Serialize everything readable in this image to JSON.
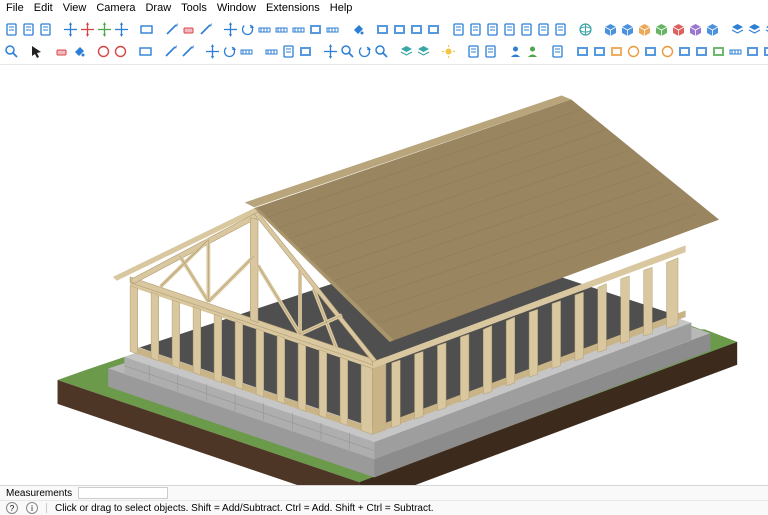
{
  "menu": {
    "items": [
      "File",
      "Edit",
      "View",
      "Camera",
      "Draw",
      "Tools",
      "Window",
      "Extensions",
      "Help"
    ]
  },
  "toolbars": {
    "row1_groups": [
      [
        "new-doc",
        "open-doc",
        "save-doc"
      ],
      [
        "move-tool",
        "red-axis",
        "green-axis",
        "blue-axis"
      ],
      [
        "rectangle-tool"
      ],
      [
        "line-tool",
        "eraser-tool",
        "offset-tool"
      ],
      [
        "move-crosshair",
        "rotate-tool",
        "scale-tool",
        "tape-tool",
        "protractor",
        "text-tool",
        "dimension-tool"
      ],
      [
        "paint-bucket"
      ],
      [
        "shadow-1",
        "shadow-2",
        "shadow-3",
        "shadow-4"
      ],
      [
        "copy-doc",
        "doc-a",
        "doc-b",
        "doc-c",
        "doc-d",
        "doc-e",
        "doc-f"
      ],
      [
        "globe-tool"
      ],
      [
        "iso-view",
        "cube-blue",
        "cube-orange",
        "cube-green",
        "cube-red",
        "cube-purple",
        "cube-cyan"
      ],
      [
        "layer-a",
        "layer-b",
        "layer-c",
        "layer-d"
      ],
      [
        "union",
        "subtract",
        "intersect",
        "trim"
      ]
    ],
    "row2_groups": [
      [
        "search-tool"
      ],
      [
        "select-tool"
      ],
      [
        "eraser-2",
        "paint-2"
      ],
      [
        "undo",
        "redo"
      ],
      [
        "rect-2"
      ],
      [
        "push-pull",
        "pencil"
      ],
      [
        "move-2",
        "rotate-2",
        "scale-2"
      ],
      [
        "tape-2",
        "doc-edit",
        "section-plane"
      ],
      [
        "pan-tool",
        "zoom-tool",
        "orbit-tool",
        "zoom-extents"
      ],
      [
        "layers-stack",
        "layers-stack-2"
      ],
      [
        "sun-icon"
      ],
      [
        "outliner",
        "scenes"
      ],
      [
        "person-icon",
        "add-person"
      ],
      [
        "warehouse-icon"
      ],
      [
        "wall-tool",
        "column-tool",
        "beam-tool",
        "roof-tool",
        "slab-tool",
        "floor-tool",
        "framing-tool",
        "truss-tool",
        "cladding-tool",
        "ruler-tool",
        "section-tool",
        "view-tool",
        "settings-tool"
      ]
    ]
  },
  "status": {
    "measurements_label": "Measurements",
    "measurements_value": "",
    "hint": "Click or drag to select objects. Shift = Add/Subtract. Ctrl = Add. Shift + Ctrl = Subtract.",
    "help_symbol": "?",
    "info_symbol": "i"
  },
  "colors": {
    "menu_text": "#333333",
    "icon_blue": "#2d7fd6",
    "icon_red": "#d64545",
    "icon_green": "#4aa84a",
    "icon_orange": "#e89a3c",
    "icon_purple": "#8a5fc7",
    "icon_teal": "#3aa6a6",
    "icon_gray": "#707070",
    "wood_light": "#d9c7a0",
    "wood_mid": "#c9b488",
    "wood_dark": "#b09a6e",
    "roof_light": "#b8a57c",
    "roof_dark": "#998560",
    "concrete": "#b8b8b8",
    "concrete_dark": "#9a9a9a",
    "block": "#c6c6c6",
    "soil": "#4d3626",
    "grass": "#6a9a4a",
    "floor": "#5a5a5a"
  }
}
